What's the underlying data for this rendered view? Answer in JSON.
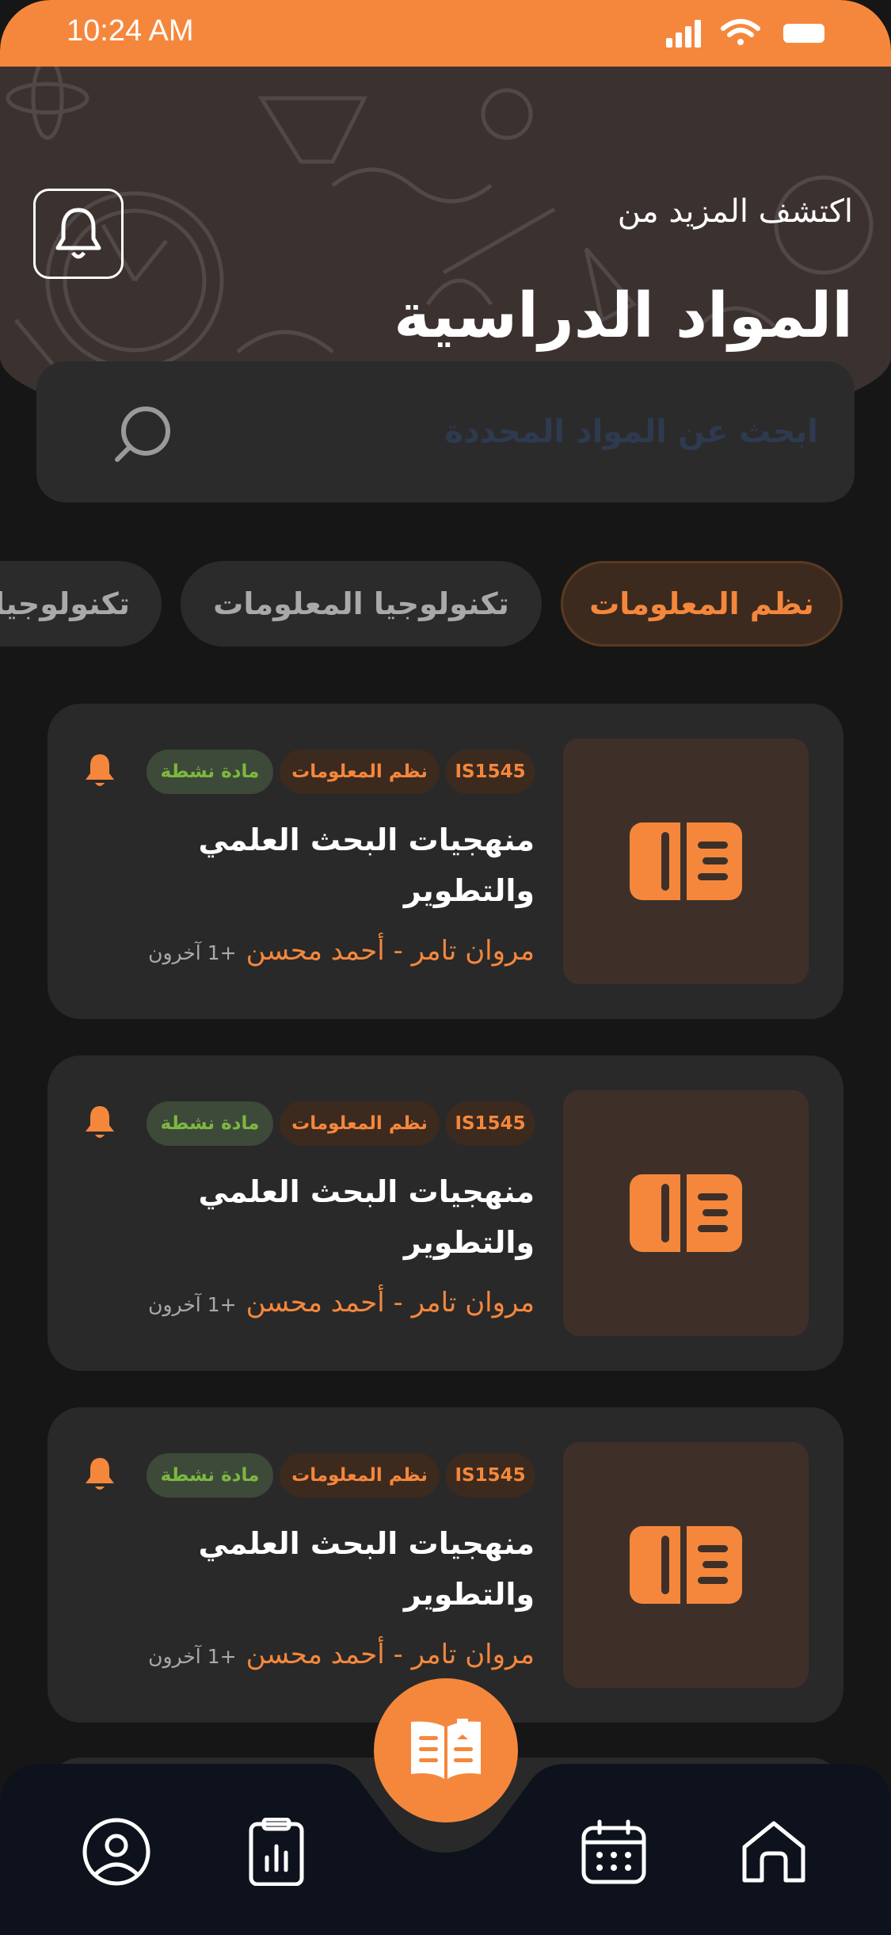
{
  "status_bar": {
    "time": "10:24 AM"
  },
  "header": {
    "subtitle": "اكتشف المزيد من",
    "title": "المواد الدراسية"
  },
  "search": {
    "placeholder": "ابحث عن المواد المحددة"
  },
  "chips": [
    {
      "label": "نظم المعلومات",
      "active": true
    },
    {
      "label": "تكنولوجيا المعلومات",
      "active": false
    },
    {
      "label": "تكنولوجيا",
      "active": false
    }
  ],
  "courses": [
    {
      "code": "IS1545",
      "department": "نظم المعلومات",
      "status": "مادة نشطة",
      "title": "منهجيات البحث العلمي والتطوير",
      "instructors": "مروان تامر - أحمد محسن",
      "others": "+1 آخرون"
    },
    {
      "code": "IS1545",
      "department": "نظم المعلومات",
      "status": "مادة نشطة",
      "title": "منهجيات البحث العلمي والتطوير",
      "instructors": "مروان تامر - أحمد محسن",
      "others": "+1 آخرون"
    },
    {
      "code": "IS1545",
      "department": "نظم المعلومات",
      "status": "مادة نشطة",
      "title": "منهجيات البحث العلمي والتطوير",
      "instructors": "مروان تامر - أحمد محسن",
      "others": "+1 آخرون"
    }
  ],
  "nav": {
    "items": [
      "profile-icon",
      "reports-icon",
      "courses-icon",
      "calendar-icon",
      "home-icon"
    ],
    "active": "courses-icon"
  },
  "colors": {
    "accent": "#F5873C",
    "background": "#161616",
    "card": "#292929",
    "header": "#3b3230",
    "active_green": "#7DB83E",
    "nav_bar": "#0d121c"
  }
}
